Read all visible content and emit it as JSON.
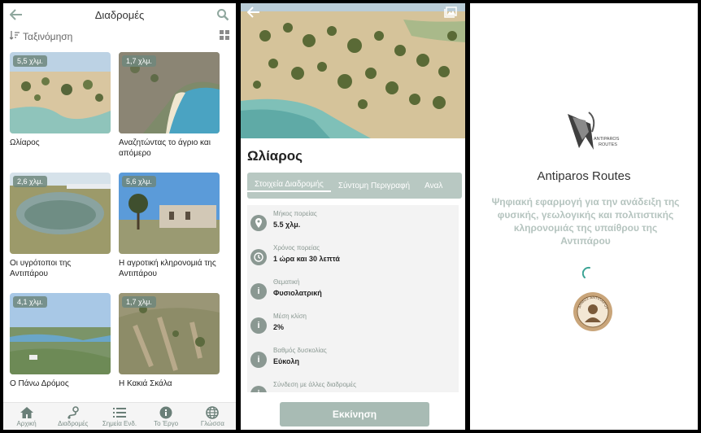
{
  "list_screen": {
    "header_title": "Διαδρομές",
    "sort_label": "Ταξινόμηση",
    "routes": [
      {
        "distance": "5,5 χλμ.",
        "name": "Ωλίαρος"
      },
      {
        "distance": "1,7 χλμ.",
        "name": "Αναζητώντας το άγριο και απόμερο"
      },
      {
        "distance": "2,6 χλμ.",
        "name": "Οι υγρότοποι της Αντιπάρου"
      },
      {
        "distance": "5,6 χλμ.",
        "name": "Η αγροτική κληρονομιά της Αντιπάρου"
      },
      {
        "distance": "4,1 χλμ.",
        "name": "Ο Πάνω Δρόμος"
      },
      {
        "distance": "1,7 χλμ.",
        "name": "Η Κακιά Σκάλα"
      }
    ],
    "tabs": [
      {
        "label": "Αρχική",
        "icon": "home-icon"
      },
      {
        "label": "Διαδρομές",
        "icon": "route-icon"
      },
      {
        "label": "Σημεία Ενδ.",
        "icon": "list-icon"
      },
      {
        "label": "Το Έργο",
        "icon": "info-icon"
      },
      {
        "label": "Γλώσσα",
        "icon": "globe-icon"
      }
    ]
  },
  "detail_screen": {
    "title": "Ωλίαρος",
    "tabs": [
      "Στοιχεία Διαδρομής",
      "Σύντομη Περιγραφή",
      "Αναλ"
    ],
    "details": [
      {
        "label": "Μήκος πορείας",
        "value": "5.5 χλμ.",
        "icon": "map-pin-icon"
      },
      {
        "label": "Χρόνος πορείας",
        "value": "1 ώρα και 30 λεπτά",
        "icon": "clock-icon"
      },
      {
        "label": "Θεματική",
        "value": "Φυσιολατρική",
        "icon": "info-icon"
      },
      {
        "label": "Μέση κλίση",
        "value": "2%",
        "icon": "info-icon"
      },
      {
        "label": "Βαθμός δυσκολίας",
        "value": "Εύκολη",
        "icon": "info-icon"
      },
      {
        "label": "Σύνδεση με άλλες διαδρομές",
        "value": "",
        "icon": "info-icon"
      }
    ],
    "start_button": "Εκκίνηση"
  },
  "splash_screen": {
    "logo_text_1": "ANTIPAROS",
    "logo_text_2": "ROUTES",
    "app_title": "Antiparos Routes",
    "description": "Ψηφιακή εφαρμογή για την ανάδειξη της φυσικής, γεωλογικής και πολιτιστικής κληρονομιάς της υπαίθρου της Αντιπάρου",
    "seal_text": "ΔΗΜΟΣ ΑΝΤΙΠΑΡΟΥ"
  },
  "colors": {
    "accent": "#8fa79e",
    "tab_bg": "#b8c8c2",
    "button_bg": "#a8bbb4",
    "muted_text": "#b5c4bf"
  }
}
